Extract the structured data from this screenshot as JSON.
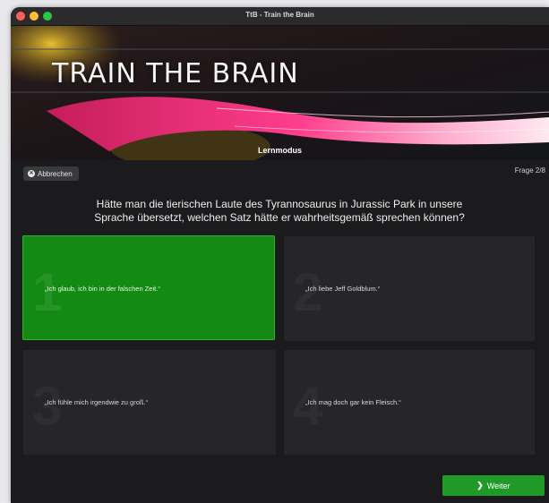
{
  "window": {
    "title": "TtB - Train the Brain"
  },
  "banner": {
    "title": "Train the Brain",
    "mode": "Lernmodus"
  },
  "toolbar": {
    "cancel_label": "Abbrechen",
    "question_counter": "Frage 2/8"
  },
  "question": {
    "line1": "Hätte man die tierischen Laute des Tyrannosaurus in Jurassic Park in unsere",
    "line2": "Sprache übersetzt, welchen Satz hätte er wahrheitsgemäß sprechen können?"
  },
  "answers": [
    {
      "number": "1",
      "text": "„Ich glaub, ich bin in der falschen Zeit.“",
      "selected": true
    },
    {
      "number": "2",
      "text": "„Ich liebe Jeff Goldblum.“",
      "selected": false
    },
    {
      "number": "3",
      "text": "„Ich fühle mich irgendwie zu groß.“",
      "selected": false
    },
    {
      "number": "4",
      "text": "„Ich mag doch gar kein Fleisch.“",
      "selected": false
    }
  ],
  "footer": {
    "next_label": "Weiter"
  },
  "colors": {
    "selected_answer": "#138a13",
    "next_button": "#1f9a28",
    "background": "#1b1b1d"
  },
  "icons": {
    "cancel": "close-circle-icon",
    "next": "chevron-right-icon"
  }
}
